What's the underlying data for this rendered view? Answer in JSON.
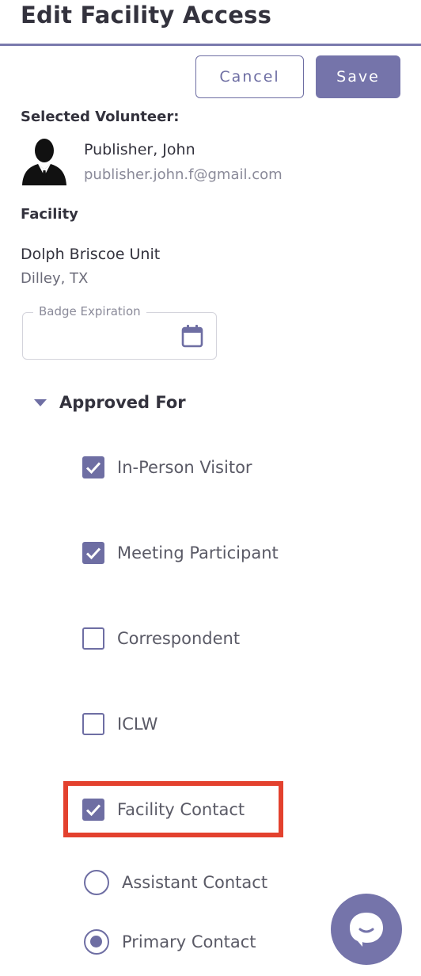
{
  "header": {
    "title": "Edit Facility Access",
    "cancel_label": "Cancel",
    "save_label": "Save"
  },
  "volunteer": {
    "section_label": "Selected Volunteer:",
    "avatar_icon": "person-silhouette-icon",
    "name": "Publisher, John",
    "email": "publisher.john.f@gmail.com"
  },
  "facility": {
    "section_label": "Facility",
    "name": "Dolph Briscoe Unit",
    "location": "Dilley, TX"
  },
  "badge": {
    "label": "Badge Expiration",
    "value": "",
    "icon": "calendar-icon"
  },
  "approved": {
    "label": "Approved For",
    "expanded": true,
    "options": [
      {
        "label": "In-Person Visitor",
        "checked": true
      },
      {
        "label": "Meeting Participant",
        "checked": true
      },
      {
        "label": "Correspondent",
        "checked": false
      },
      {
        "label": "ICLW",
        "checked": false
      },
      {
        "label": "Facility Contact",
        "checked": true,
        "highlighted": true
      }
    ],
    "contact_types": [
      {
        "label": "Assistant Contact",
        "selected": false
      },
      {
        "label": "Primary Contact",
        "selected": true
      }
    ]
  },
  "chat": {
    "icon": "chat-bubble-icon"
  },
  "colors": {
    "accent": "#7574aa",
    "highlight": "#e3412e",
    "text": "#33323d",
    "muted": "#8a8a99"
  }
}
